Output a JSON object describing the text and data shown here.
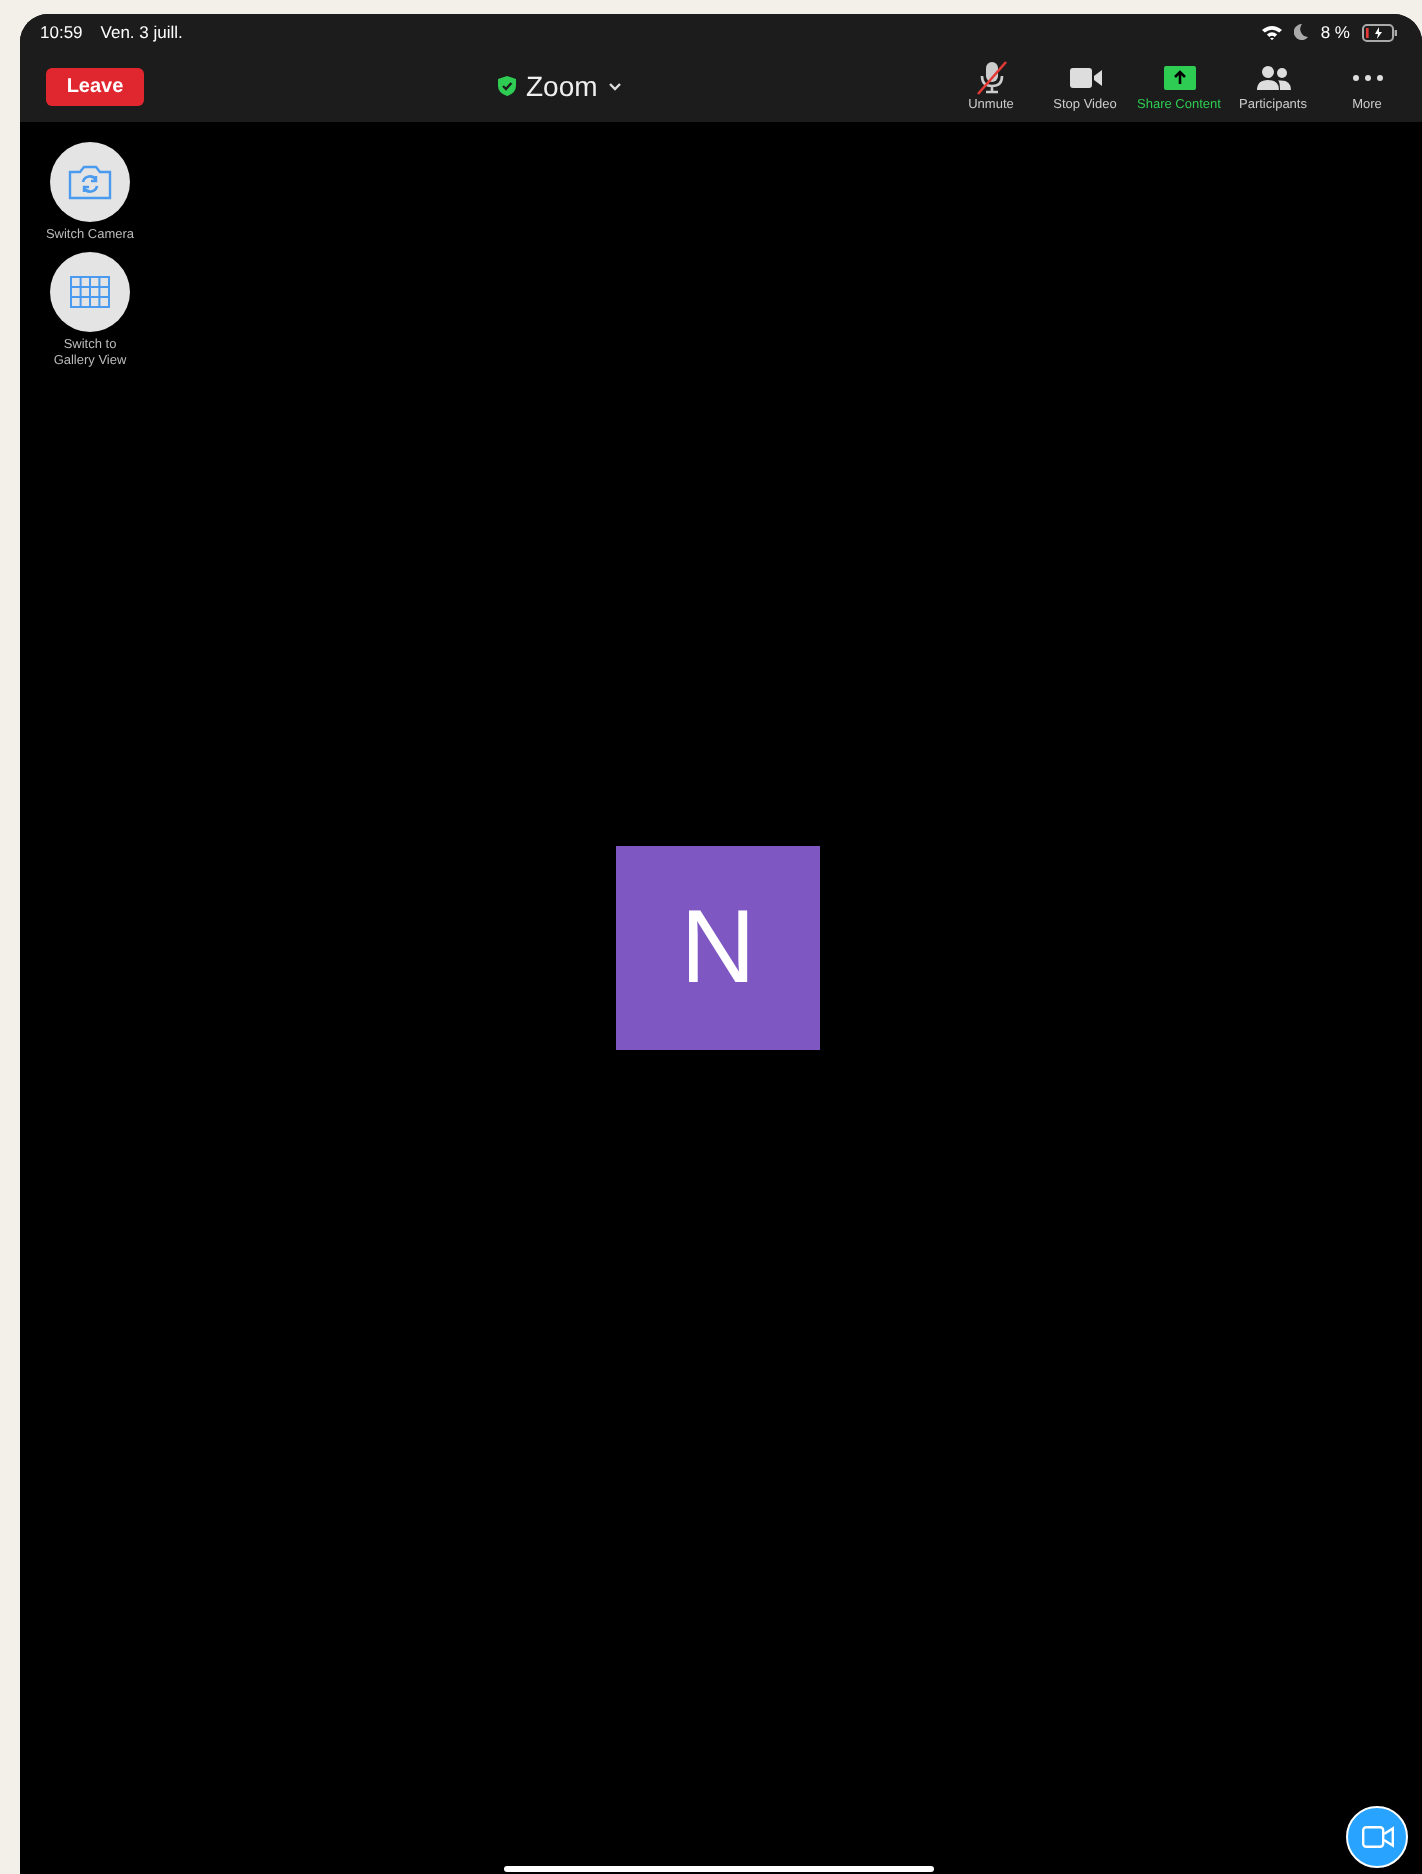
{
  "status_bar": {
    "time": "10:59",
    "date": "Ven. 3 juill.",
    "battery": "8 %"
  },
  "toolbar": {
    "leave": "Leave",
    "title": "Zoom",
    "actions": [
      {
        "kind": "mic-muted",
        "label": "Unmute",
        "selected": false
      },
      {
        "kind": "video",
        "label": "Stop Video",
        "selected": false
      },
      {
        "kind": "share",
        "label": "Share Content",
        "selected": true
      },
      {
        "kind": "participants",
        "label": "Participants",
        "selected": false
      },
      {
        "kind": "more",
        "label": "More",
        "selected": false
      }
    ]
  },
  "side_buttons": [
    {
      "kind": "switch-camera",
      "label": "Switch Camera"
    },
    {
      "kind": "gallery",
      "label": "Switch to Gallery View"
    }
  ],
  "participant": {
    "initial": "N",
    "color": "#7e57c2"
  }
}
